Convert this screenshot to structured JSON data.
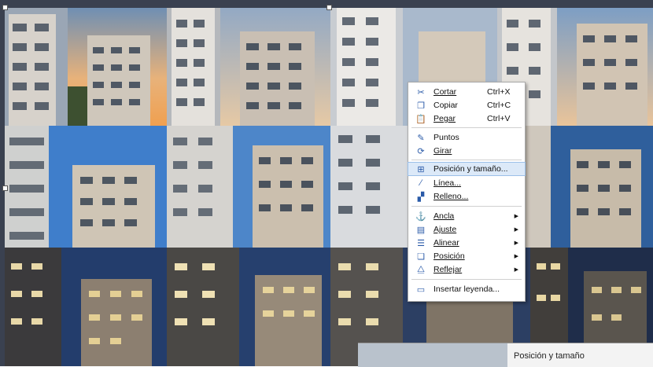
{
  "context_menu": {
    "items": [
      {
        "name": "cut",
        "icon": "scissors-icon",
        "label": "Cortar",
        "shortcut": "Ctrl+X"
      },
      {
        "name": "copy",
        "icon": "copy-icon",
        "label": "Copiar",
        "shortcut": "Ctrl+C"
      },
      {
        "name": "paste",
        "icon": "paste-icon",
        "label": "Pegar",
        "shortcut": "Ctrl+V"
      },
      {
        "name": "points",
        "icon": "points-icon",
        "label": "Puntos"
      },
      {
        "name": "rotate",
        "icon": "rotate-icon",
        "label": "Girar"
      },
      {
        "name": "position-size",
        "icon": "position-size-icon",
        "label": "Posición y tamaño..."
      },
      {
        "name": "line",
        "icon": "line-icon",
        "label": "Línea..."
      },
      {
        "name": "fill",
        "icon": "fill-icon",
        "label": "Relleno..."
      },
      {
        "name": "anchor",
        "icon": "anchor-icon",
        "label": "Ancla"
      },
      {
        "name": "wrap",
        "icon": "wrap-icon",
        "label": "Ajuste"
      },
      {
        "name": "align",
        "icon": "align-icon",
        "label": "Alinear"
      },
      {
        "name": "arrange",
        "icon": "arrange-icon",
        "label": "Posición"
      },
      {
        "name": "flip",
        "icon": "flip-icon",
        "label": "Reflejar"
      },
      {
        "name": "insert-caption",
        "icon": "caption-icon",
        "label": "Insertar leyenda..."
      }
    ]
  },
  "dialog": {
    "title": "Posición y tamaño"
  },
  "colors": {
    "highlight": "#dce9f8",
    "accent": "#2a5aa8"
  }
}
